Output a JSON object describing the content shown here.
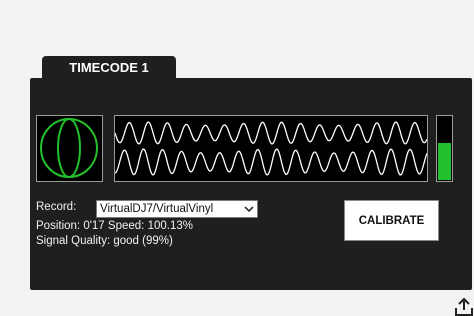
{
  "tab": {
    "label": "TIMECODE 1"
  },
  "record": {
    "label": "Record:",
    "selected": "VirtualDJ7/VirtualVinyl"
  },
  "position": {
    "label": "Position:",
    "value": "0'17"
  },
  "speed": {
    "label": "Speed:",
    "value": "100.13%"
  },
  "signal": {
    "label": "Signal Quality:",
    "value": "good (99%)"
  },
  "calibrate_button": {
    "label": "CALIBRATE"
  },
  "signal_meter_level": 0.6,
  "colors": {
    "scope": "#22c12b",
    "wave": "#ffffff",
    "meter": "#22c12b",
    "panel": "#1f1f1f"
  },
  "icons": {
    "scope": "phase-scope-icon",
    "select_chevron": "chevron-down-icon",
    "corner": "export-icon"
  }
}
